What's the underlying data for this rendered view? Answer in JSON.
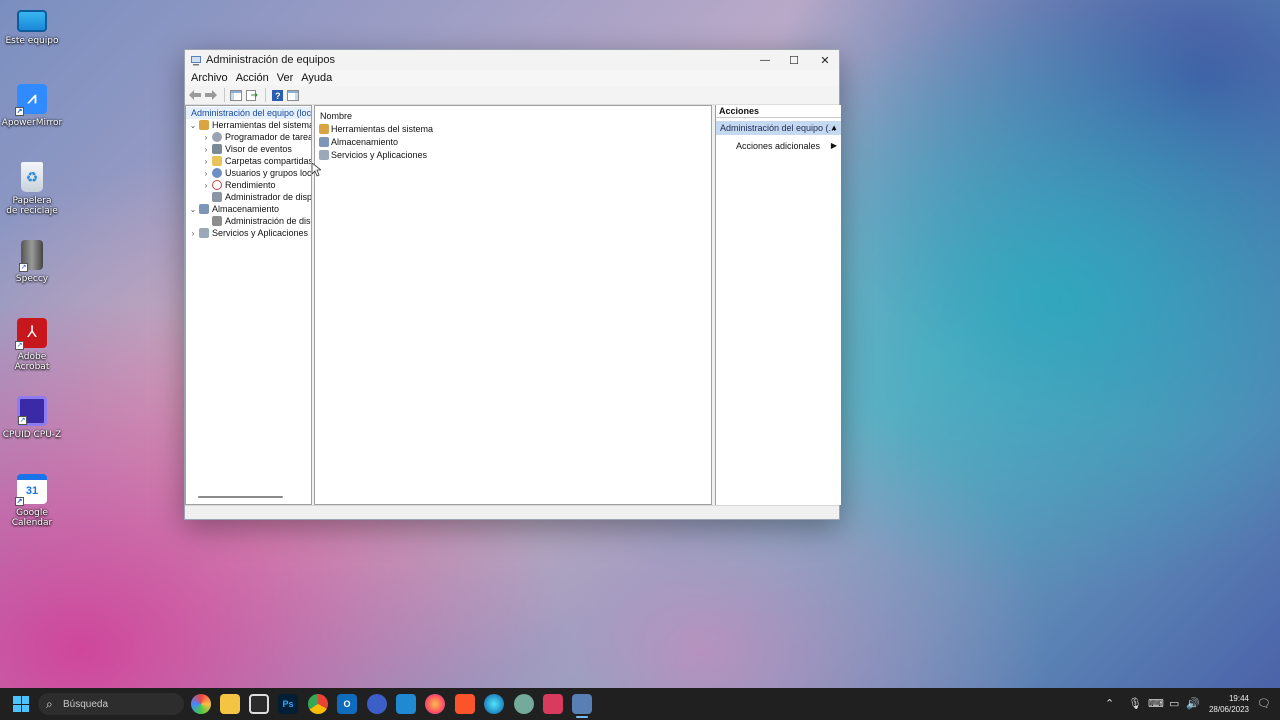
{
  "desktop": {
    "icons": [
      {
        "label": "Este equipo",
        "icon": "monitor-icon"
      },
      {
        "label": "ApowerMirror",
        "icon": "apowermirror-icon"
      },
      {
        "label": "Papelera de reciclaje",
        "icon": "recycle-bin-icon"
      },
      {
        "label": "Speccy",
        "icon": "speccy-icon"
      },
      {
        "label": "Adobe Acrobat",
        "icon": "acrobat-icon"
      },
      {
        "label": "CPUID CPU-Z",
        "icon": "cpuz-icon"
      },
      {
        "label": "Google Calendar",
        "icon": "google-calendar-icon",
        "badge": "31"
      }
    ]
  },
  "window": {
    "title": "Administración de equipos",
    "controls": {
      "minimize": "—",
      "maximize": "☐",
      "close": "✕"
    },
    "menu": [
      "Archivo",
      "Acción",
      "Ver",
      "Ayuda"
    ],
    "tree": {
      "root": "Administración del equipo (local)",
      "items": [
        {
          "label": "Herramientas del sistema",
          "level": 1,
          "expander": "⌄"
        },
        {
          "label": "Programador de tareas",
          "level": 2,
          "expander": "›"
        },
        {
          "label": "Visor de eventos",
          "level": 2,
          "expander": "›"
        },
        {
          "label": "Carpetas compartidas",
          "level": 2,
          "expander": "›"
        },
        {
          "label": "Usuarios y grupos locales",
          "level": 2,
          "expander": "›"
        },
        {
          "label": "Rendimiento",
          "level": 2,
          "expander": "›"
        },
        {
          "label": "Administrador de dispositivos",
          "level": 2,
          "expander": ""
        },
        {
          "label": "Almacenamiento",
          "level": 1,
          "expander": "⌄"
        },
        {
          "label": "Administración de discos",
          "level": 2,
          "expander": ""
        },
        {
          "label": "Servicios y Aplicaciones",
          "level": 1,
          "expander": "›"
        }
      ]
    },
    "content": {
      "column_header": "Nombre",
      "rows": [
        "Herramientas del sistema",
        "Almacenamiento",
        "Servicios y Aplicaciones"
      ]
    },
    "actions": {
      "header": "Acciones",
      "section": "Administración del equipo (...",
      "item": "Acciones adicionales"
    }
  },
  "taskbar": {
    "search_placeholder": "Búsqueda",
    "time": "19:44",
    "date": "28/06/2023",
    "apps": [
      "chrome-like-app",
      "file-explorer",
      "store",
      "photoshop",
      "chrome",
      "outlook",
      "vpn",
      "vscode",
      "firefox",
      "brave",
      "edge",
      "chatgpt",
      "capture",
      "computer-management"
    ]
  },
  "colors": {
    "accent": "#1b4aa0",
    "action_section_bg": "#c5d9f0",
    "taskbar_bg": "#202020"
  }
}
